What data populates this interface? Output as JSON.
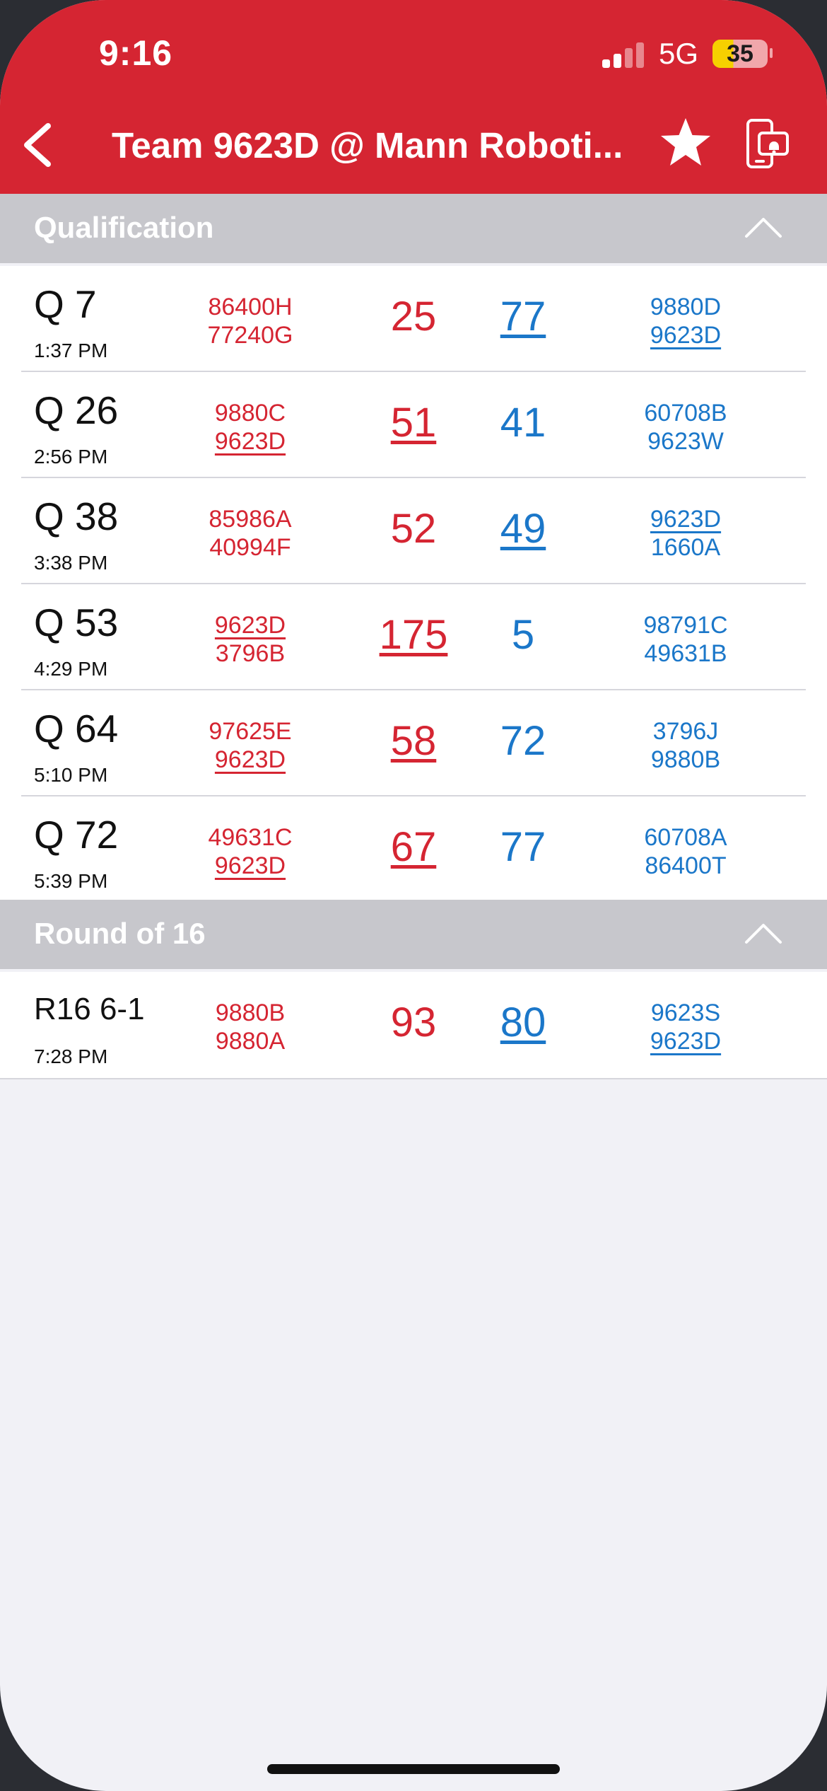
{
  "status_bar": {
    "time": "9:16",
    "network": "5G",
    "battery": "35"
  },
  "nav": {
    "title": "Team 9623D @ Mann Roboti..."
  },
  "colors": {
    "red_alliance": "#d52532",
    "blue_alliance": "#1b77c9",
    "header": "#d52532",
    "section": "#c7c7cc"
  },
  "sections": [
    {
      "title": "Qualification",
      "matches": [
        {
          "name": "Q 7",
          "time": "1:37 PM",
          "red_teams": [
            "86400H",
            "77240G"
          ],
          "red_score": "25",
          "blue_score": "77",
          "blue_teams": [
            "9880D",
            "9623D"
          ]
        },
        {
          "name": "Q 26",
          "time": "2:56 PM",
          "red_teams": [
            "9880C",
            "9623D"
          ],
          "red_score": "51",
          "blue_score": "41",
          "blue_teams": [
            "60708B",
            "9623W"
          ]
        },
        {
          "name": "Q 38",
          "time": "3:38 PM",
          "red_teams": [
            "85986A",
            "40994F"
          ],
          "red_score": "52",
          "blue_score": "49",
          "blue_teams": [
            "9623D",
            "1660A"
          ]
        },
        {
          "name": "Q 53",
          "time": "4:29 PM",
          "red_teams": [
            "9623D",
            "3796B"
          ],
          "red_score": "175",
          "blue_score": "5",
          "blue_teams": [
            "98791C",
            "49631B"
          ]
        },
        {
          "name": "Q 64",
          "time": "5:10 PM",
          "red_teams": [
            "97625E",
            "9623D"
          ],
          "red_score": "58",
          "blue_score": "72",
          "blue_teams": [
            "3796J",
            "9880B"
          ]
        },
        {
          "name": "Q 72",
          "time": "5:39 PM",
          "red_teams": [
            "49631C",
            "9623D"
          ],
          "red_score": "67",
          "blue_score": "77",
          "blue_teams": [
            "60708A",
            "86400T"
          ]
        }
      ]
    },
    {
      "title": "Round of 16",
      "matches": [
        {
          "name": "R16 6-1",
          "time": "7:28 PM",
          "red_teams": [
            "9880B",
            "9880A"
          ],
          "red_score": "93",
          "blue_score": "80",
          "blue_teams": [
            "9623S",
            "9623D"
          ]
        }
      ]
    }
  ]
}
